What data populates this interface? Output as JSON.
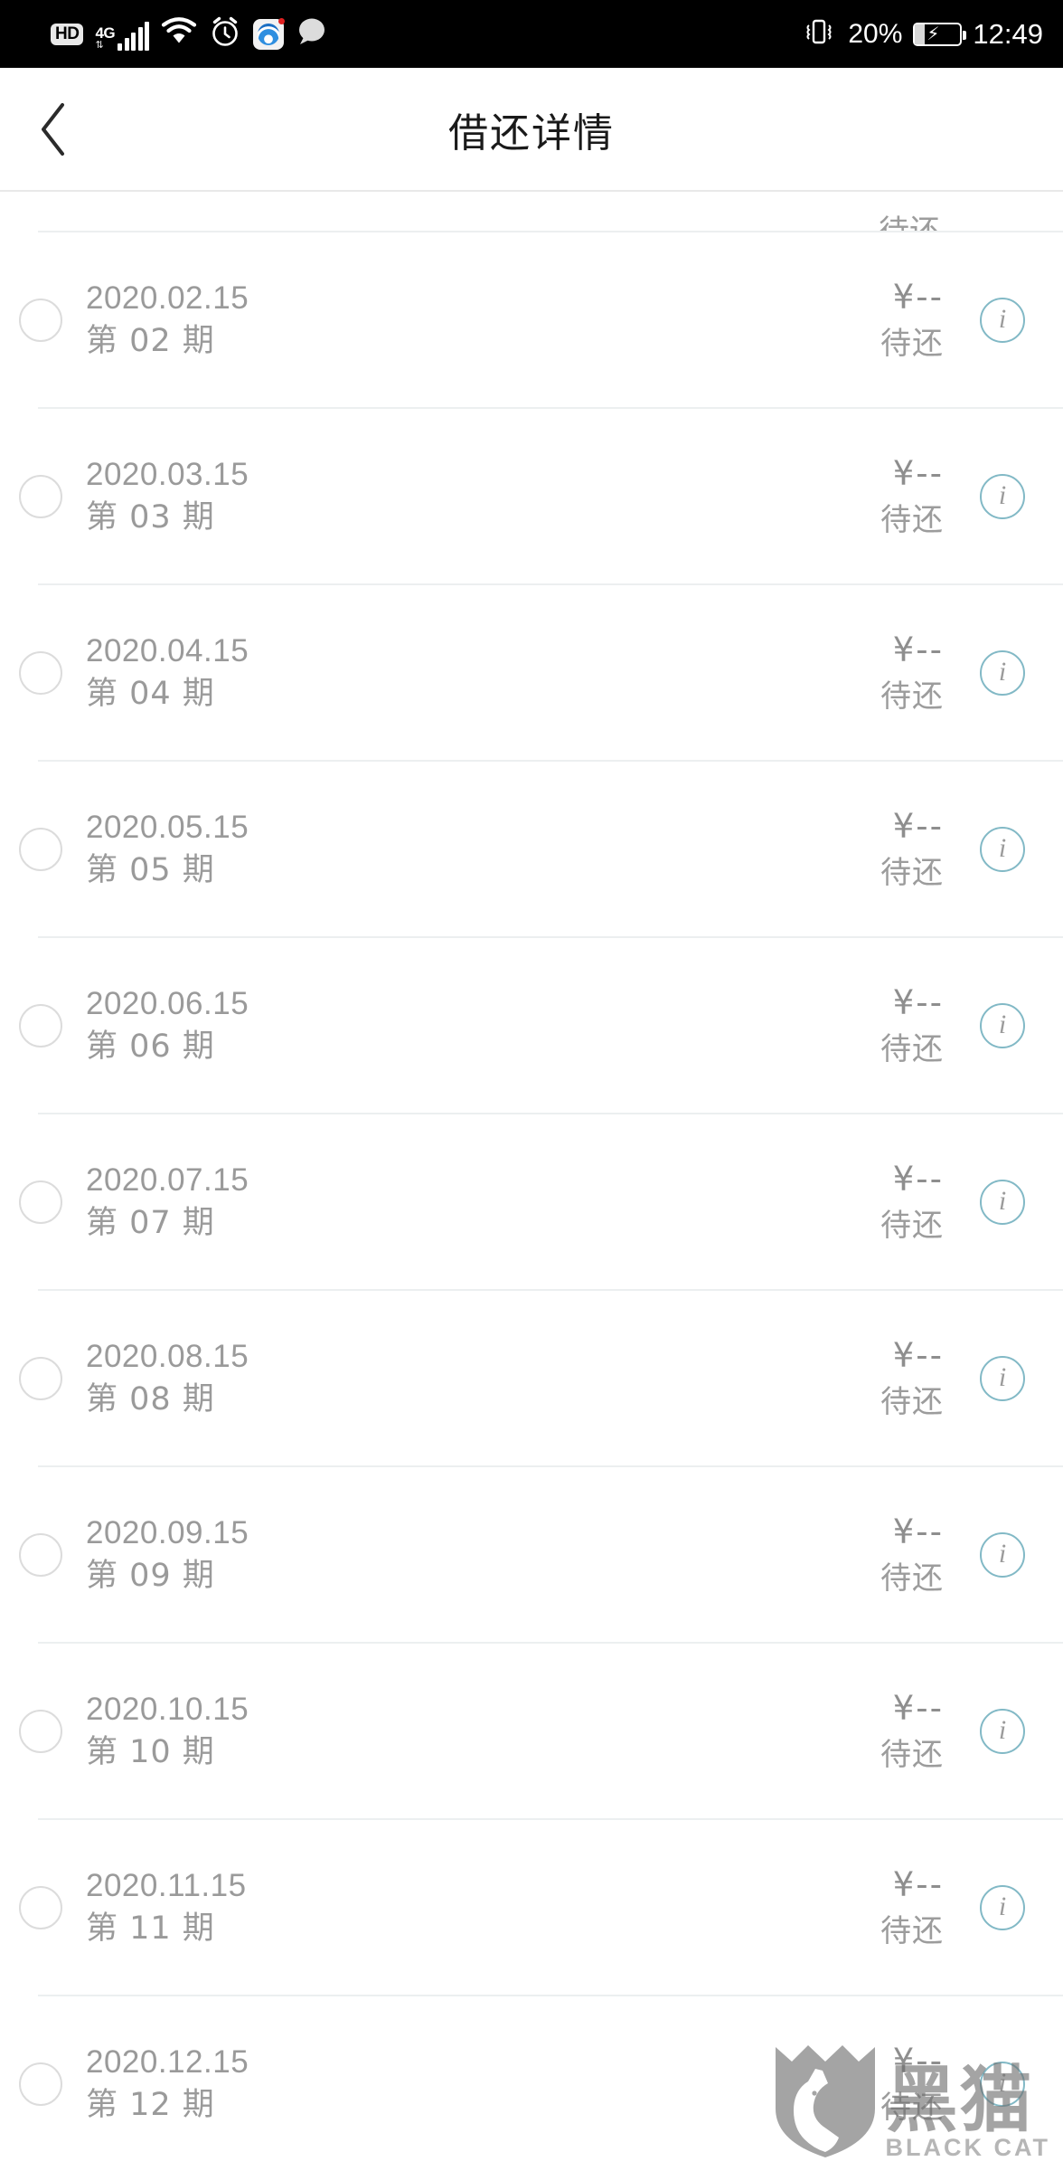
{
  "status_bar": {
    "hd_label": "HD",
    "network_label": "4G",
    "network_arrows": "⇅",
    "icons": [
      "hd-badge",
      "signal-4g-icon",
      "wifi-icon",
      "alarm-clock-icon",
      "app-icon",
      "chat-bubble-icon"
    ],
    "vibrate_icon": "vibrate-icon",
    "battery_percent": "20%",
    "battery_icon": "battery-charging-icon",
    "time": "12:49"
  },
  "header": {
    "back_icon": "back-chevron-icon",
    "title": "借还详情"
  },
  "list": {
    "partial_top_row_status": "待还",
    "amount_placeholder": "¥--",
    "status_pending": "待还",
    "info_icon_glyph": "i",
    "rows": [
      {
        "date": "2020.02.15",
        "term": "第 02 期",
        "amount": "¥--",
        "status": "待还"
      },
      {
        "date": "2020.03.15",
        "term": "第 03 期",
        "amount": "¥--",
        "status": "待还"
      },
      {
        "date": "2020.04.15",
        "term": "第 04 期",
        "amount": "¥--",
        "status": "待还"
      },
      {
        "date": "2020.05.15",
        "term": "第 05 期",
        "amount": "¥--",
        "status": "待还"
      },
      {
        "date": "2020.06.15",
        "term": "第 06 期",
        "amount": "¥--",
        "status": "待还"
      },
      {
        "date": "2020.07.15",
        "term": "第 07 期",
        "amount": "¥--",
        "status": "待还"
      },
      {
        "date": "2020.08.15",
        "term": "第 08 期",
        "amount": "¥--",
        "status": "待还"
      },
      {
        "date": "2020.09.15",
        "term": "第 09 期",
        "amount": "¥--",
        "status": "待还"
      },
      {
        "date": "2020.10.15",
        "term": "第 10 期",
        "amount": "¥--",
        "status": "待还"
      },
      {
        "date": "2020.11.15",
        "term": "第 11 期",
        "amount": "¥--",
        "status": "待还"
      },
      {
        "date": "2020.12.15",
        "term": "第 12 期",
        "amount": "¥--",
        "status": "待还"
      }
    ]
  },
  "watermark": {
    "cn_text": "黑猫",
    "en_text": "BLACK CAT",
    "logo_icon": "black-cat-shield-logo"
  },
  "colors": {
    "status_bar_bg": "#000000",
    "page_bg": "#ffffff",
    "title_text": "#1a1a1a",
    "body_text": "#9a9a9a",
    "separator": "#eceff0",
    "info_ring_teal": "#82b9c6",
    "checkbox_border": "#dcdcdc"
  }
}
